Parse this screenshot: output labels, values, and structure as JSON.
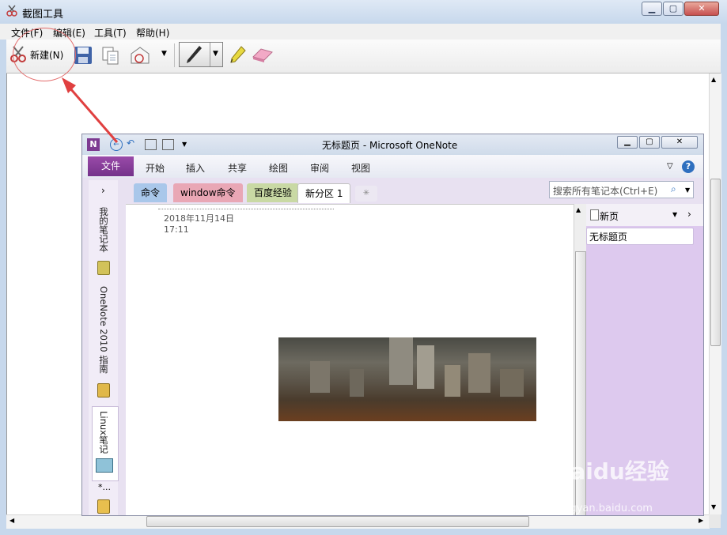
{
  "window": {
    "title": "截图工具"
  },
  "menu": [
    "文件(F)",
    "编辑(E)",
    "工具(T)",
    "帮助(H)"
  ],
  "toolbar": {
    "new_label": "新建(N)"
  },
  "onenote": {
    "title": "无标题页 - Microsoft OneNote",
    "file_tab": "文件",
    "ribbon_tabs": [
      "开始",
      "插入",
      "共享",
      "绘图",
      "审阅",
      "视图"
    ],
    "section_tabs": [
      "命令",
      "window命令",
      "百度经验",
      "新分区 1"
    ],
    "search_placeholder": "搜索所有笔记本(Ctrl+E)",
    "notebooks": [
      "我的笔记本",
      "OneNote 2010 指南",
      "Linux笔记"
    ],
    "page_date": "2018年11月14日",
    "page_time": "17:11",
    "new_page_label": "新页",
    "page_list": [
      "无标题页"
    ],
    "expand_glyph": "›",
    "more_glyph": "*..."
  },
  "watermark": {
    "brand": "Baidu经验",
    "url": "jingyan.baidu.com"
  },
  "colors": {
    "file_tab": "#7d3a91",
    "annotation": "#e36b6b",
    "pages_pane": "#ddc9ee"
  }
}
